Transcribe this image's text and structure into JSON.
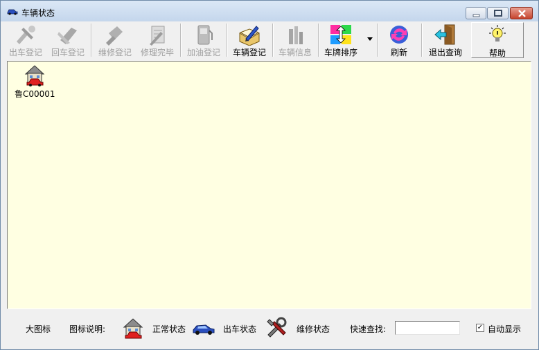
{
  "window": {
    "title": "车辆状态"
  },
  "toolbar": {
    "items": [
      {
        "label": "出车登记",
        "icon": "car-out-icon",
        "enabled": false
      },
      {
        "label": "回车登记",
        "icon": "car-return-icon",
        "enabled": false
      },
      {
        "label": "维修登记",
        "icon": "repair-icon",
        "enabled": false
      },
      {
        "label": "修理完毕",
        "icon": "repair-done-icon",
        "enabled": false
      },
      {
        "label": "加油登记",
        "icon": "fuel-pump-icon",
        "enabled": false
      },
      {
        "label": "车辆登记",
        "icon": "register-book-icon",
        "enabled": true
      },
      {
        "label": "车辆信息",
        "icon": "vehicle-info-icon",
        "enabled": false
      },
      {
        "label": "车牌排序",
        "icon": "sort-arrows-icon",
        "enabled": true
      },
      {
        "label": "刷新",
        "icon": "refresh-icon",
        "enabled": true
      },
      {
        "label": "退出查询",
        "icon": "exit-door-icon",
        "enabled": true
      },
      {
        "label": "帮助",
        "icon": "lightbulb-icon",
        "enabled": true
      }
    ]
  },
  "vehicles": [
    {
      "plate": "鲁C00001",
      "status": "正常状态"
    }
  ],
  "statusbar": {
    "view_mode": "大图标",
    "legend_label": "图标说明:",
    "legend": [
      {
        "label": "正常状态",
        "icon": "house-car-icon"
      },
      {
        "label": "出车状态",
        "icon": "car-icon"
      },
      {
        "label": "维修状态",
        "icon": "tools-icon"
      }
    ],
    "search_label": "快速查找:",
    "search_value": "",
    "auto_display_label": "自动显示",
    "auto_display_checked": true
  },
  "colors": {
    "content_bg": "#ffffe2",
    "disabled_text": "#a0a0a0",
    "accent": "#1a73c8"
  }
}
